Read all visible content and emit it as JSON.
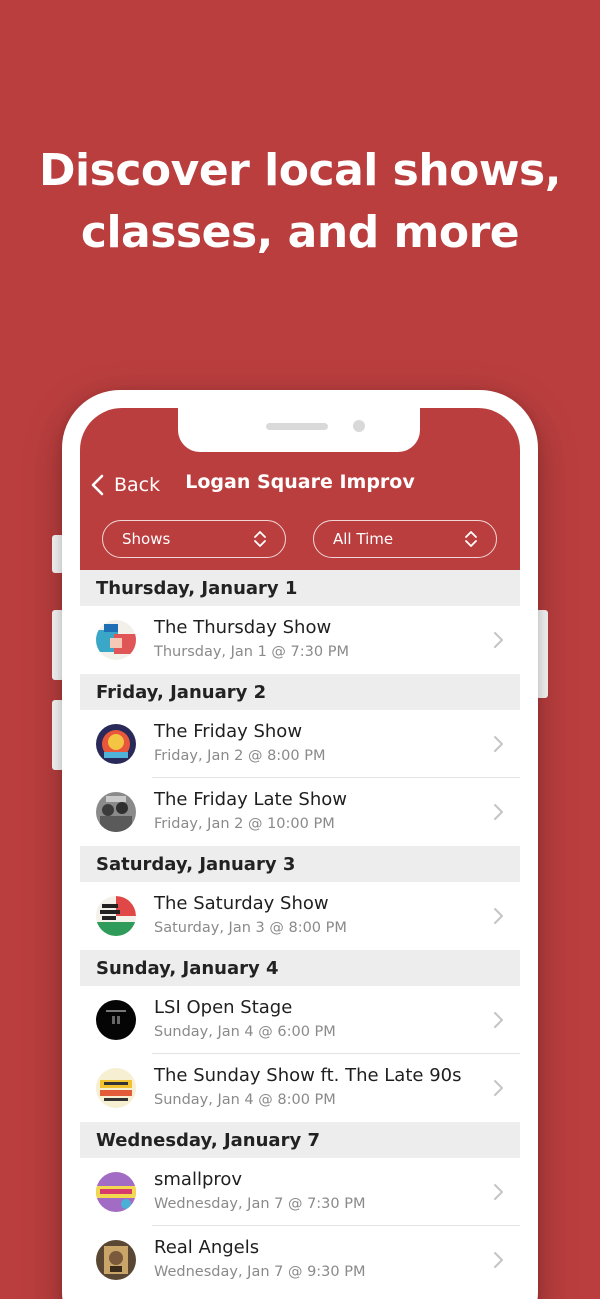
{
  "headline": {
    "line1": "Discover local shows,",
    "line2": "classes, and more"
  },
  "nav": {
    "back_label": "Back",
    "title": "Logan Square Improv"
  },
  "filters": {
    "type": "Shows",
    "time": "All Time"
  },
  "days": [
    {
      "label": "Thursday, January 1",
      "events": [
        {
          "title": "The Thursday Show",
          "subtitle": "Thursday, Jan 1 @ 7:30 PM",
          "icon": "thursday-show-thumbnail"
        }
      ]
    },
    {
      "label": "Friday, January 2",
      "events": [
        {
          "title": "The Friday Show",
          "subtitle": "Friday, Jan 2 @ 8:00 PM",
          "icon": "friday-show-thumbnail"
        },
        {
          "title": "The Friday Late Show",
          "subtitle": "Friday, Jan 2 @ 10:00 PM",
          "icon": "friday-late-show-thumbnail"
        }
      ]
    },
    {
      "label": "Saturday, January 3",
      "events": [
        {
          "title": "The Saturday Show",
          "subtitle": "Saturday, Jan 3 @ 8:00 PM",
          "icon": "saturday-show-thumbnail"
        }
      ]
    },
    {
      "label": "Sunday, January 4",
      "events": [
        {
          "title": "LSI Open Stage",
          "subtitle": "Sunday, Jan 4 @ 6:00 PM",
          "icon": "open-stage-thumbnail"
        },
        {
          "title": "The Sunday Show ft. The Late 90s",
          "subtitle": "Sunday, Jan 4 @ 8:00 PM",
          "icon": "sunday-show-thumbnail"
        }
      ]
    },
    {
      "label": "Wednesday, January 7",
      "events": [
        {
          "title": "smallprov",
          "subtitle": "Wednesday, Jan 7 @ 7:30 PM",
          "icon": "smallprov-thumbnail"
        },
        {
          "title": "Real Angels",
          "subtitle": "Wednesday, Jan 7 @ 9:30 PM",
          "icon": "real-angels-thumbnail"
        }
      ]
    }
  ],
  "colors": {
    "brand_red": "#bb3e3e",
    "section_bg": "#ededed",
    "subtitle_gray": "#8a8a8a"
  }
}
